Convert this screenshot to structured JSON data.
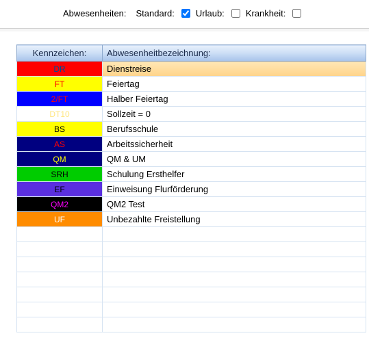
{
  "filters": {
    "title": "Abwesenheiten:",
    "standard_label": "Standard:",
    "standard_checked": true,
    "urlaub_label": "Urlaub:",
    "urlaub_checked": false,
    "krankheit_label": "Krankheit:",
    "krankheit_checked": false
  },
  "grid": {
    "col_kz": "Kennzeichen:",
    "col_desc": "Abwesenheitbezeichnung:",
    "rows": [
      {
        "code": "DR",
        "desc": "Dienstreise",
        "bg": "#ff0000",
        "fg": "#004b96",
        "selected": true
      },
      {
        "code": "FT",
        "desc": "Feiertag",
        "bg": "#ffff00",
        "fg": "#ff0000"
      },
      {
        "code": "2/FT",
        "desc": "Halber Feiertag",
        "bg": "#0000ff",
        "fg": "#ff0000"
      },
      {
        "code": "DT10",
        "desc": "Sollzeit = 0",
        "bg": "#ffffff",
        "fg": "#ffe680"
      },
      {
        "code": "BS",
        "desc": "Berufsschule",
        "bg": "#ffff00",
        "fg": "#000000"
      },
      {
        "code": "AS",
        "desc": "Arbeitssicherheit",
        "bg": "#000080",
        "fg": "#ff0000"
      },
      {
        "code": "QM",
        "desc": "QM & UM",
        "bg": "#000080",
        "fg": "#ffff00"
      },
      {
        "code": "SRH",
        "desc": "Schulung Ersthelfer",
        "bg": "#00cc00",
        "fg": "#000000"
      },
      {
        "code": "EF",
        "desc": "Einweisung Flurförderung",
        "bg": "#5a2fe0",
        "fg": "#000000"
      },
      {
        "code": "QM2",
        "desc": "QM2 Test",
        "bg": "#000000",
        "fg": "#ff00ff"
      },
      {
        "code": "UF",
        "desc": "Unbezahlte Freistellung",
        "bg": "#ff8c00",
        "fg": "#ffffff"
      }
    ],
    "empty_rows": 7
  },
  "chart_data": {
    "type": "table",
    "columns": [
      "Kennzeichen",
      "Abwesenheitbezeichnung"
    ],
    "rows": [
      [
        "DR",
        "Dienstreise"
      ],
      [
        "FT",
        "Feiertag"
      ],
      [
        "2/FT",
        "Halber Feiertag"
      ],
      [
        "DT10",
        "Sollzeit = 0"
      ],
      [
        "BS",
        "Berufsschule"
      ],
      [
        "AS",
        "Arbeitssicherheit"
      ],
      [
        "QM",
        "QM & UM"
      ],
      [
        "SRH",
        "Schulung Ersthelfer"
      ],
      [
        "EF",
        "Einweisung Flurförderung"
      ],
      [
        "QM2",
        "QM2 Test"
      ],
      [
        "UF",
        "Unbezahlte Freistellung"
      ]
    ]
  }
}
